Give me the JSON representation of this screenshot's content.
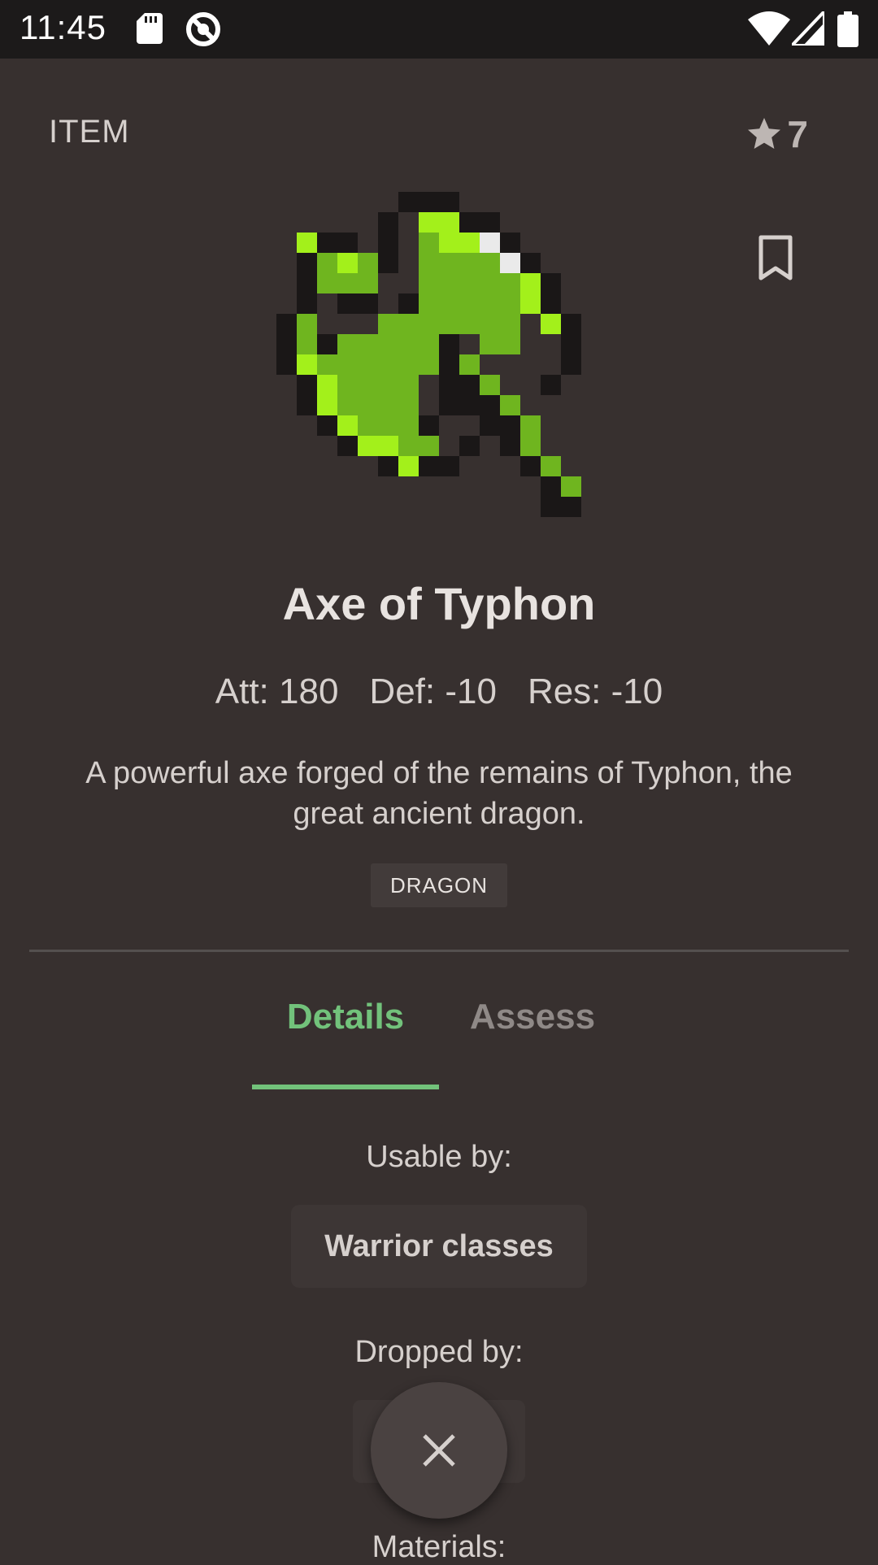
{
  "status_bar": {
    "time": "11:45"
  },
  "header": {
    "item_type": "ITEM",
    "rating_count": "7"
  },
  "item": {
    "name": "Axe of Typhon",
    "stats": [
      "Att: 180",
      "Def: -10",
      "Res: -10"
    ],
    "description": "A powerful axe forged of the remains of Typhon, the great ancient dragon.",
    "tag": "DRAGON"
  },
  "tabs": [
    {
      "label": "Details",
      "selected": true
    },
    {
      "label": "Assess",
      "selected": false
    }
  ],
  "details": {
    "usable_by_label": "Usable by:",
    "usable_by_value": "Warrior classes",
    "dropped_by_label": "Dropped by:",
    "materials_label": "Materials:"
  },
  "colors": {
    "background": "#37302f",
    "accent": "#72c27b",
    "status_bar": "#1c1a1a",
    "chip": "#3d3635",
    "fab": "#4a4241"
  },
  "icons": {
    "status": [
      "sd-card-icon",
      "blocked-icon",
      "wifi-icon",
      "signal-icon",
      "battery-icon"
    ],
    "rating": "star-icon",
    "bookmark": "bookmark-icon",
    "fab": "close-icon"
  }
}
